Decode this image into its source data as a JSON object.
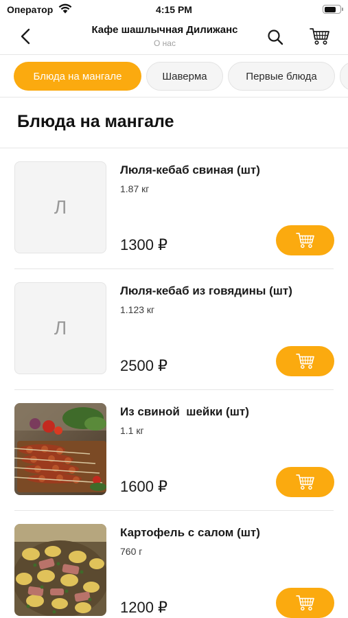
{
  "status_bar": {
    "carrier": "Оператор",
    "time": "4:15 PM",
    "battery_level": 0.8
  },
  "nav": {
    "title": "Кафе шашлычная Дилижанс",
    "subtitle": "О нас",
    "back_icon": "chevron-left-icon",
    "search_icon": "search-icon",
    "cart_icon": "cart-icon"
  },
  "categories": [
    {
      "label": "Блюда на мангале",
      "active": true
    },
    {
      "label": "Шаверма",
      "active": false
    },
    {
      "label": "Первые блюда",
      "active": false
    }
  ],
  "section": {
    "title": "Блюда на мангале"
  },
  "products": [
    {
      "name": "Люля-кебаб свиная (шт)",
      "weight": "1.87 кг",
      "price": "1300 ₽",
      "placeholder": "Л"
    },
    {
      "name": "Люля-кебаб из говядины (шт)",
      "weight": "1.123 кг",
      "price": "2500 ₽",
      "placeholder": "Л"
    },
    {
      "name": "Из свиной  шейки (шт)",
      "weight": "1.1 кг",
      "price": "1600 ₽"
    },
    {
      "name": "Картофель с салом (шт)",
      "weight": "760 г",
      "price": "1200 ₽"
    }
  ],
  "colors": {
    "accent": "#fbaa0f",
    "divider": "#e6e6e6",
    "muted_text": "#a0a0a0"
  }
}
